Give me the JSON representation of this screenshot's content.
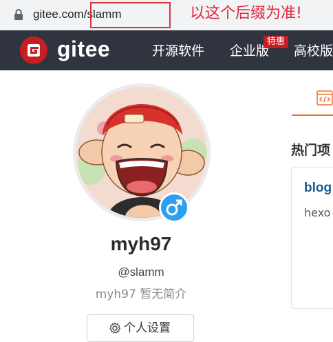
{
  "browser": {
    "url_host": "gitee.com/",
    "url_path": "slamm",
    "annotation": "以这个后缀为准!"
  },
  "nav": {
    "logo_text": "gitee",
    "items": [
      {
        "label": "开源软件"
      },
      {
        "label": "企业版",
        "badge": "特惠"
      },
      {
        "label": "高校版"
      }
    ]
  },
  "profile": {
    "display_name": "myh97",
    "handle": "@slamm",
    "bio": "myh97 暂无简介",
    "settings_label": "个人设置",
    "gender": "male"
  },
  "right": {
    "section_title": "热门项",
    "repo_name": "blog",
    "repo_desc": "hexo"
  },
  "colors": {
    "nav_bg": "#2f343f",
    "brand_red": "#c71d23",
    "annotation_red": "#e0283a",
    "gender_blue": "#2d9ff1",
    "tab_orange": "#f0712c"
  }
}
